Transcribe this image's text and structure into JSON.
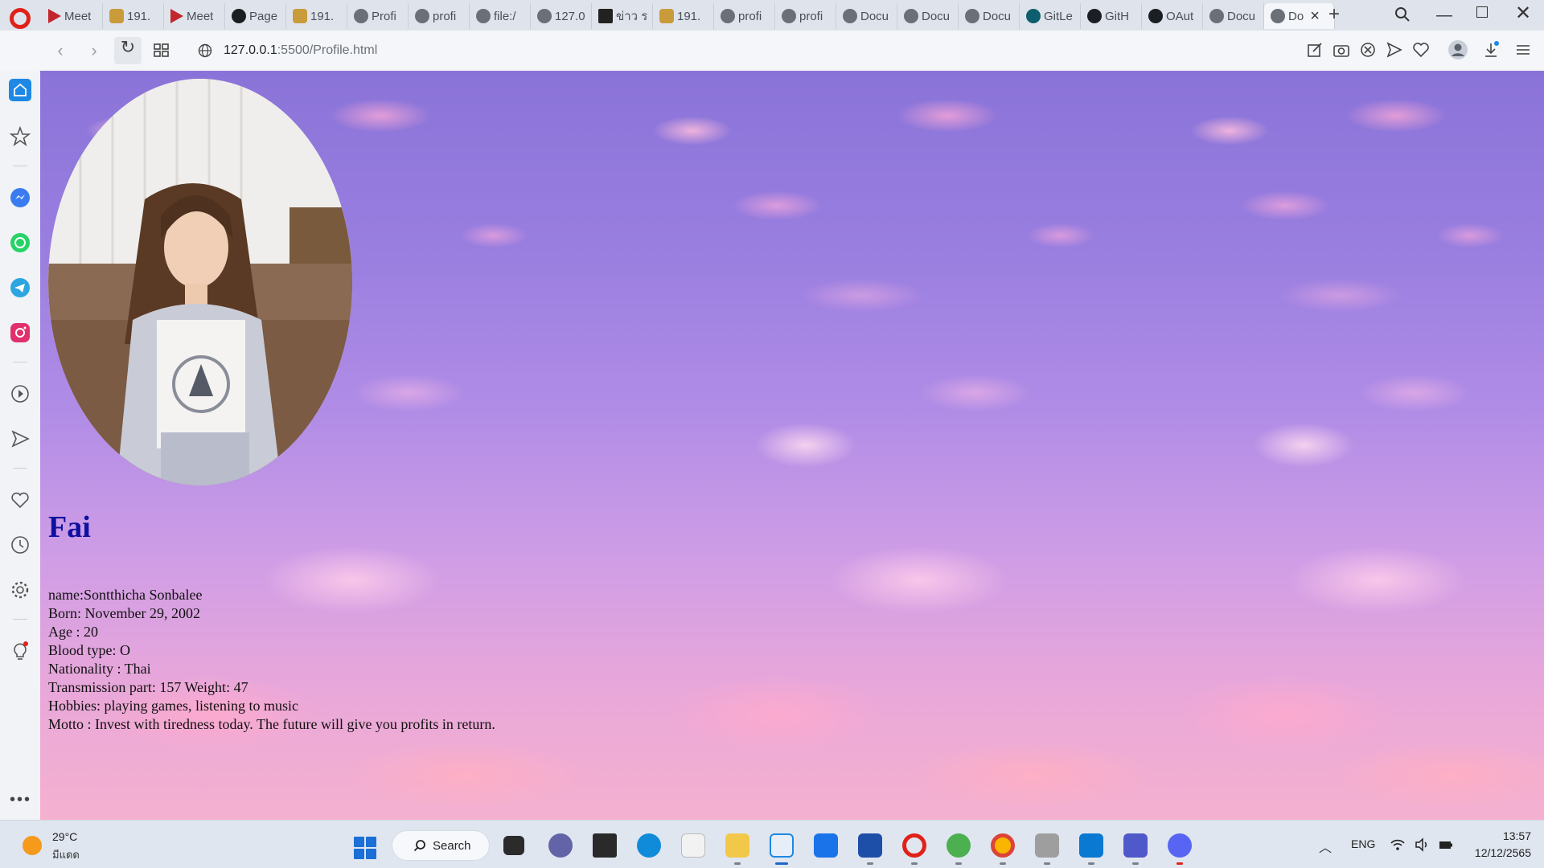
{
  "browser": {
    "tabs": [
      {
        "label": "Meet",
        "icon": "meet-icon"
      },
      {
        "label": "191.",
        "icon": "lock-icon"
      },
      {
        "label": "Meet",
        "icon": "meet-icon"
      },
      {
        "label": "Page",
        "icon": "github-icon"
      },
      {
        "label": "191.",
        "icon": "lock-icon"
      },
      {
        "label": "Profi",
        "icon": "globe-icon"
      },
      {
        "label": "profi",
        "icon": "globe-icon"
      },
      {
        "label": "file:/",
        "icon": "globe-icon"
      },
      {
        "label": "127.0",
        "icon": "globe-icon"
      },
      {
        "label": "ข่าว ร",
        "icon": "news-icon"
      },
      {
        "label": "191.",
        "icon": "lock-icon"
      },
      {
        "label": "profi",
        "icon": "globe-icon"
      },
      {
        "label": "profi",
        "icon": "globe-icon"
      },
      {
        "label": "Docu",
        "icon": "globe-icon"
      },
      {
        "label": "Docu",
        "icon": "globe-icon"
      },
      {
        "label": "Docu",
        "icon": "globe-icon"
      },
      {
        "label": "GitLe",
        "icon": "gitlens-icon"
      },
      {
        "label": "GitH",
        "icon": "github-icon"
      },
      {
        "label": "OAut",
        "icon": "github-icon"
      },
      {
        "label": "Docu",
        "icon": "globe-icon"
      }
    ],
    "active_tab": {
      "label": "Do",
      "icon": "globe-icon"
    },
    "url_host": "127.0.0.1",
    "url_rest": ":5500/Profile.html"
  },
  "profile": {
    "name": "Fai",
    "details": [
      "name:Sontthicha Sonbalee",
      "Born: November 29, 2002",
      "Age : 20",
      "Blood type: O",
      "Nationality : Thai",
      "Transmission part: 157 Weight: 47",
      "Hobbies: playing games, listening to music",
      "Motto : Invest with tiredness today. The future will give you profits in return."
    ]
  },
  "taskbar": {
    "weather_temp": "29°C",
    "weather_desc": "มีแดด",
    "search_label": "Search",
    "language": "ENG",
    "time": "13:57",
    "date": "12/12/2565"
  },
  "colors": {
    "opera_red": "#e0211a",
    "name_blue": "#1010a0",
    "sky_top": "#8a73d8",
    "sky_bottom": "#f5b1cf"
  }
}
